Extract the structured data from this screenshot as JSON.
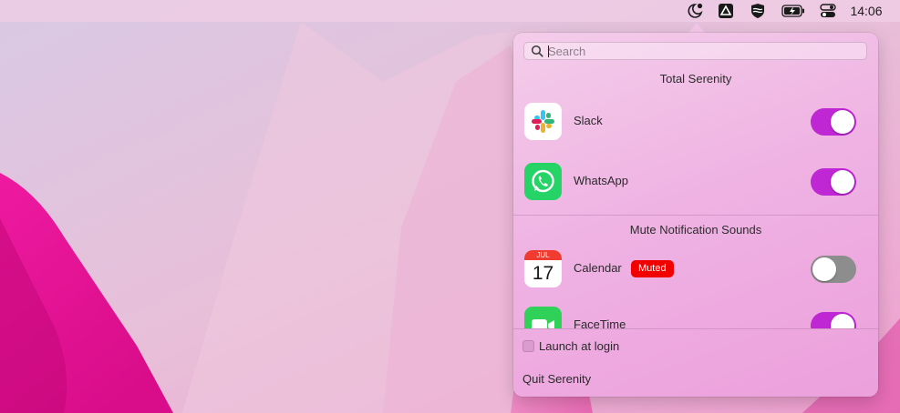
{
  "menubar": {
    "icons": [
      "serenity-moon-icon",
      "drive-icon",
      "shield-icon",
      "battery-charging-icon",
      "control-center-icon"
    ],
    "clock": "14:06"
  },
  "popover": {
    "search": {
      "placeholder": "Search",
      "value": ""
    },
    "sections": {
      "total_serenity": "Total Serenity",
      "mute_sounds": "Mute Notification Sounds"
    },
    "apps": [
      {
        "name": "Slack",
        "icon": "slack-icon",
        "enabled": true
      },
      {
        "name": "WhatsApp",
        "icon": "whatsapp-icon",
        "enabled": true
      },
      {
        "name": "Calendar",
        "icon": "calendar-icon",
        "enabled": false,
        "badge": "Muted",
        "calendar_month": "JUL",
        "calendar_day": "17"
      },
      {
        "name": "FaceTime",
        "icon": "facetime-icon",
        "enabled": true
      }
    ],
    "launch_at_login": {
      "label": "Launch at login",
      "checked": false
    },
    "quit_label": "Quit Serenity"
  },
  "colors": {
    "toggle_on": "#bf26d4",
    "toggle_off": "#8d8d8d",
    "muted_badge": "#f20000",
    "accent_magenta": "#e8198f"
  }
}
